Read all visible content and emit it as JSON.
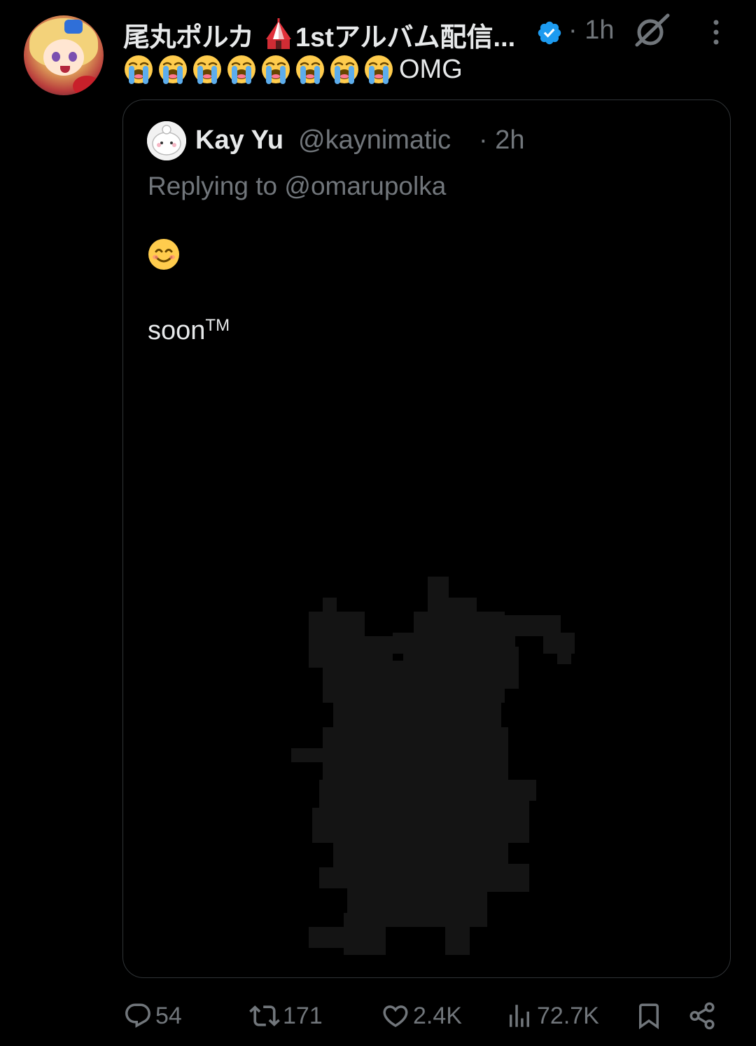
{
  "tweet": {
    "author_name_part1": "尾丸ポルカ",
    "author_name_part2": "1stアルバム配信...",
    "time": "· 1h",
    "text_suffix": "OMG",
    "crying_emoji_count": 8
  },
  "quoted": {
    "name": "Kay Yu",
    "handle": "@kaynimatic",
    "time": "· 2h",
    "replying_to": "Replying to @omarupolka",
    "text": "soon",
    "text_superscript": "TM"
  },
  "actions": {
    "replies": "54",
    "retweets": "171",
    "likes": "2.4K",
    "views": "72.7K"
  },
  "colors": {
    "background": "#000000",
    "text": "#e7e9ea",
    "muted": "#71767b",
    "border": "#2f3336",
    "verified": "#1d9bf0"
  },
  "icons": [
    "avatar",
    "tent-emoji-icon",
    "verified-badge-icon",
    "grok-icon",
    "more-icon",
    "crying-emoji-icon",
    "smile-emoji-icon",
    "reply-icon",
    "retweet-icon",
    "like-icon",
    "views-icon",
    "bookmark-icon",
    "share-icon"
  ]
}
